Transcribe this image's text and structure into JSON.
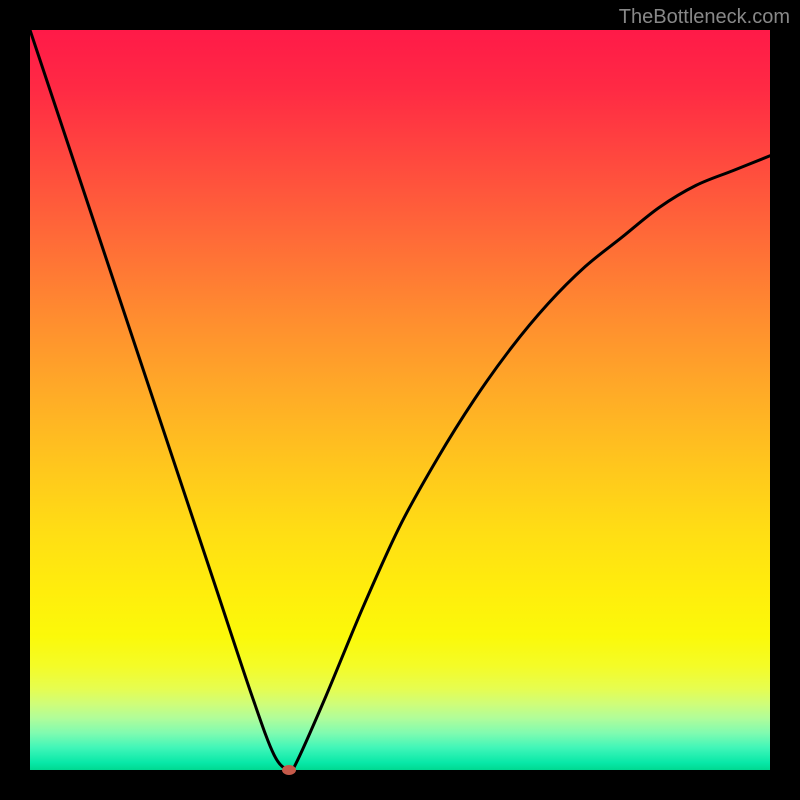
{
  "watermark": "TheBottleneck.com",
  "chart_data": {
    "type": "line",
    "title": "",
    "xlabel": "",
    "ylabel": "",
    "xlim": [
      0,
      100
    ],
    "ylim": [
      0,
      100
    ],
    "series": [
      {
        "name": "bottleneck-curve",
        "x": [
          0,
          5,
          10,
          15,
          20,
          25,
          30,
          33,
          35,
          36,
          40,
          45,
          50,
          55,
          60,
          65,
          70,
          75,
          80,
          85,
          90,
          95,
          100
        ],
        "y": [
          100,
          85,
          70,
          55,
          40,
          25,
          10,
          2,
          0,
          1,
          10,
          22,
          33,
          42,
          50,
          57,
          63,
          68,
          72,
          76,
          79,
          81,
          83
        ]
      }
    ],
    "marker": {
      "x": 35,
      "y": 0
    },
    "gradient_bands": [
      {
        "pct": 0,
        "color": "#ff1a48"
      },
      {
        "pct": 50,
        "color": "#ffc41e"
      },
      {
        "pct": 85,
        "color": "#fbf90a"
      },
      {
        "pct": 100,
        "color": "#00d890"
      }
    ]
  }
}
